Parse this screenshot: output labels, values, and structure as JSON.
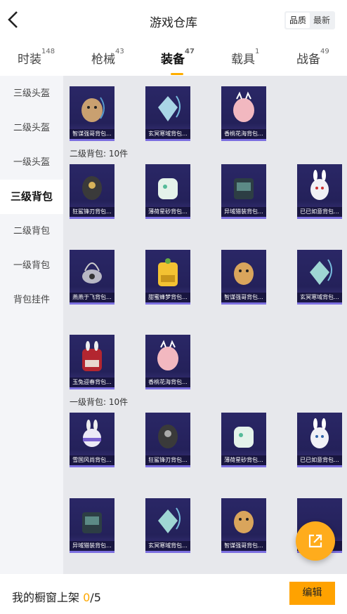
{
  "header": {
    "title": "游戏仓库",
    "sort_options": [
      "品质",
      "最新"
    ],
    "sort_selected": "品质"
  },
  "tabs": [
    {
      "label": "时装",
      "count": "148"
    },
    {
      "label": "枪械",
      "count": "43"
    },
    {
      "label": "装备",
      "count": "47"
    },
    {
      "label": "载具",
      "count": "1"
    },
    {
      "label": "战备",
      "count": "49"
    }
  ],
  "sidebar": [
    "三级头盔",
    "二级头盔",
    "一级头盔",
    "三级背包",
    "二级背包",
    "一级背包",
    "背包挂件"
  ],
  "sidebar_active": "三级背包",
  "sections": {
    "top_items": [
      "智谋强哥背包...",
      "玄冥寒域背包...",
      "香桃花海背包..."
    ],
    "level2_label": "二级背包: 10件",
    "level2_items": [
      "狂鲨锋刃背包...",
      "薄荷星砂背包...",
      "异域猎装背包...",
      "已已如意背包...",
      "燕燕于飞背包...",
      "甜蜜蜂梦背包...",
      "智谋强哥背包...",
      "玄冥寒域背包...",
      "玉兔迎春背包...",
      "香桃花海背包..."
    ],
    "level1_label": "一级背包: 10件",
    "level1_items": [
      "雪国风尚背包...",
      "狂鲨锋刃背包...",
      "薄荷星砂背包...",
      "已已如意背包...",
      "异域猎装背包...",
      "玄冥寒域背包...",
      "智谋强哥背包...",
      ""
    ]
  },
  "bottom": {
    "shelf_label": "我的橱窗上架",
    "shelf_count": "0",
    "shelf_total": "/5",
    "edit_label": "编辑"
  },
  "colors": {
    "accent": "#ffa200",
    "card_bg": "#2a2766",
    "card_border": "#7c6fe0"
  },
  "icons": {
    "back": "chevron-left-icon",
    "fab": "share-out-icon"
  }
}
